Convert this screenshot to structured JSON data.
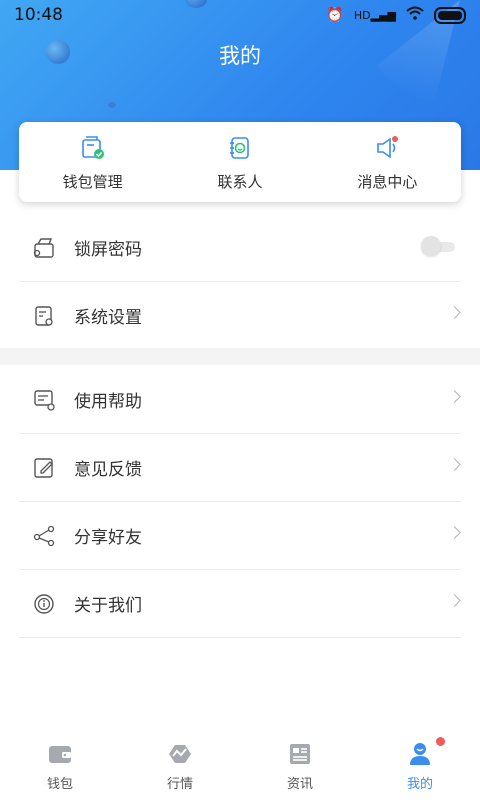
{
  "status_bar": {
    "time": "10:48",
    "network": "HD"
  },
  "page_title": "我的",
  "quick_actions": [
    {
      "label": "钱包管理",
      "icon": "wallet-manage-icon"
    },
    {
      "label": "联系人",
      "icon": "contacts-icon"
    },
    {
      "label": "消息中心",
      "icon": "message-center-icon"
    }
  ],
  "settings_group1": [
    {
      "label": "锁屏密码",
      "icon": "lock-screen-icon",
      "control": "toggle",
      "enabled": false
    },
    {
      "label": "系统设置",
      "icon": "system-settings-icon",
      "control": "chevron"
    }
  ],
  "settings_group2": [
    {
      "label": "使用帮助",
      "icon": "help-icon",
      "control": "chevron"
    },
    {
      "label": "意见反馈",
      "icon": "feedback-icon",
      "control": "chevron"
    },
    {
      "label": "分享好友",
      "icon": "share-icon",
      "control": "chevron"
    },
    {
      "label": "关于我们",
      "icon": "about-icon",
      "control": "chevron"
    }
  ],
  "bottom_nav": [
    {
      "label": "钱包",
      "icon": "wallet-icon",
      "active": false
    },
    {
      "label": "行情",
      "icon": "market-icon",
      "active": false
    },
    {
      "label": "资讯",
      "icon": "news-icon",
      "active": false
    },
    {
      "label": "我的",
      "icon": "profile-icon",
      "active": true,
      "badge": true
    }
  ],
  "colors": {
    "accent": "#3b8ef0",
    "header_start": "#41a7f3",
    "header_end": "#2a78e6",
    "badge": "#f05a5a",
    "icon_green": "#2bc37a"
  }
}
